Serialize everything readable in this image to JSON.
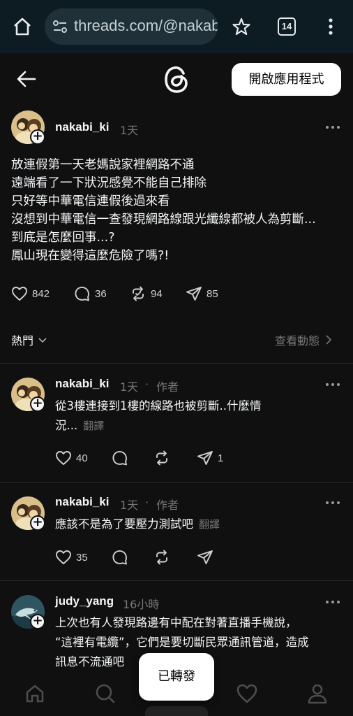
{
  "browser": {
    "url": "threads.com/@nakabi_ki",
    "tab_count": "14"
  },
  "header": {
    "open_app_label": "開啟應用程式"
  },
  "post": {
    "username": "nakabi_ki",
    "time": "1天",
    "lines": [
      "放連假第一天老媽說家裡網路不通",
      "遠端看了一下狀況感覺不能自己排除",
      "只好等中華電信連假後過來看",
      "沒想到中華電信一查發現網路線跟光纖線都被人為剪斷...",
      "到底是怎麼回事...?",
      "鳳山現在變得這麼危險了嗎?!"
    ],
    "likes": "842",
    "replies": "36",
    "reposts": "94",
    "shares": "85"
  },
  "sort": {
    "label": "熱門",
    "view_activity": "查看動態"
  },
  "replies": [
    {
      "username": "nakabi_ki",
      "time": "1天",
      "author_tag": "作者",
      "line1": "從3樓連接到1樓的線路也被剪斷..什麼情",
      "line2": "況...",
      "translate": "翻譯",
      "likes": "40",
      "shares": "1"
    },
    {
      "username": "nakabi_ki",
      "time": "1天",
      "author_tag": "作者",
      "line1": "應該不是為了要壓力測試吧",
      "translate": "翻譯",
      "likes": "35"
    },
    {
      "username": "judy_yang",
      "time": "16小時",
      "line1": "上次也有人發現路邊有中配在對著直播手機說，",
      "line2": "“這裡有電纜”，它們是要切斷民眾通訊管道，造成",
      "line3": "訊息不流通吧"
    }
  ],
  "toast": {
    "label": "已轉發"
  },
  "colors": {
    "background": "#101010",
    "browser_bar": "#0d1b22",
    "muted_text": "#777777"
  }
}
